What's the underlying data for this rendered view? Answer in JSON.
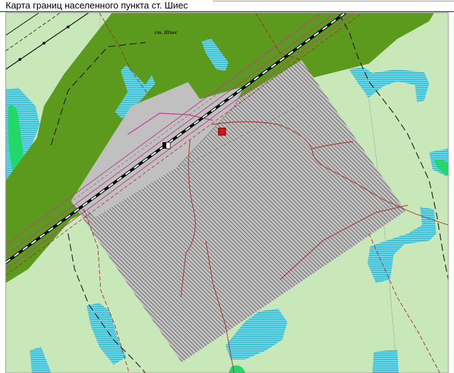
{
  "title": "Карта границ населенного пункта ст. Шиес",
  "map": {
    "settlement_label": "ст. Шиес"
  },
  "colors": {
    "background": "#c9e8b9",
    "forest": "#5b9a1c",
    "settlement": "#b4b4b4",
    "settlement_hatch": "#555555",
    "water": "#2fc0d8",
    "wetland": "#22d868",
    "railway": "#000000",
    "roads": "#a52a2a",
    "rail_corridor": "#c0408a",
    "marker": "#e01010"
  }
}
